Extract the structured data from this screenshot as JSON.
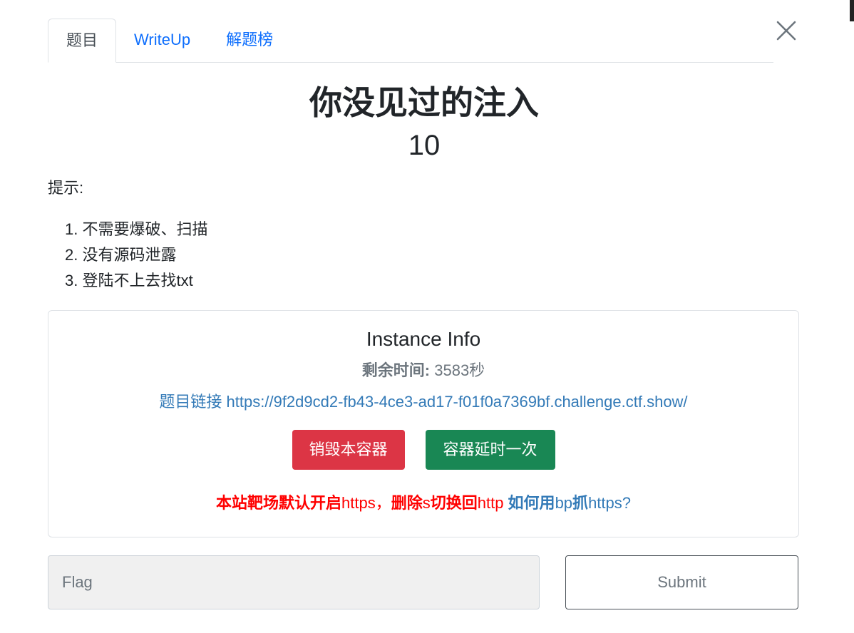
{
  "tabs": [
    {
      "label": "题目",
      "active": true
    },
    {
      "label": "WriteUp",
      "active": false
    },
    {
      "label": "解题榜",
      "active": false
    }
  ],
  "close_icon": "close-icon",
  "challenge": {
    "title": "你没见过的注入",
    "points": "10",
    "hint_label": "提示:",
    "hints": [
      "1. 不需要爆破、扫描",
      "2. 没有源码泄露",
      "3. 登陆不上去找txt"
    ]
  },
  "instance": {
    "title": "Instance Info",
    "time_label": "剩余时间:",
    "time_value": " 3583秒",
    "link_label": "题目链接 ",
    "link_url": "https://9f2d9cd2-fb43-4ce3-ad17-f01f0a7369bf.challenge.ctf.show/",
    "destroy_button": "销毁本容器",
    "extend_button": "容器延时一次",
    "notice_bold_1": "本站靶场默认开启",
    "notice_text_1": "https，",
    "notice_bold_2": "删除",
    "notice_text_2": "s",
    "notice_bold_3": "切换回",
    "notice_text_3": "http ",
    "notice_link_bold_1": "如何用",
    "notice_link_text_1": "bp",
    "notice_link_bold_2": "抓",
    "notice_link_text_2": "https?"
  },
  "flag_form": {
    "placeholder": "Flag",
    "value": "",
    "submit_label": "Submit"
  },
  "colors": {
    "tab_link": "#0d6efd",
    "link_blue": "#337ab7",
    "danger": "#dc3545",
    "success": "#198754",
    "notice_red": "#ff0000"
  }
}
